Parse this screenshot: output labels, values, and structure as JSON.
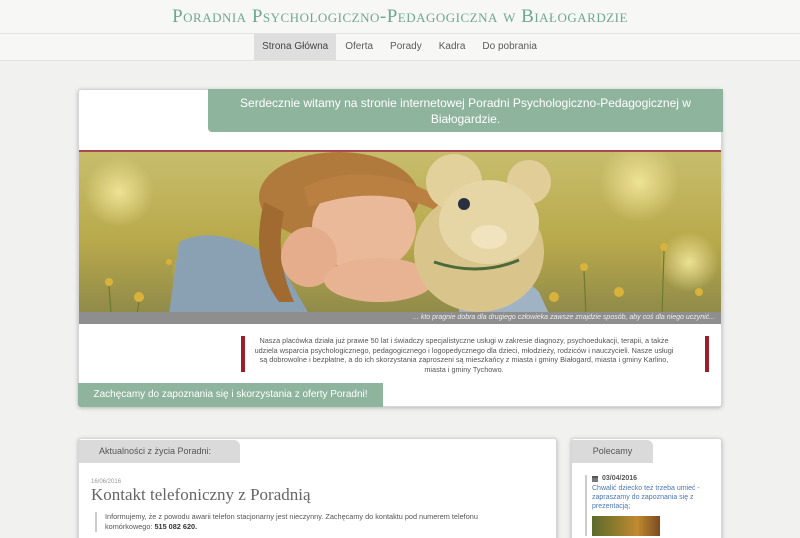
{
  "site": {
    "title": "Poradnia Psychologiczno-Pedagogiczna w Białogardzie"
  },
  "nav": {
    "items": [
      {
        "label": "Strona Główna",
        "active": true
      },
      {
        "label": "Oferta",
        "active": false
      },
      {
        "label": "Porady",
        "active": false
      },
      {
        "label": "Kadra",
        "active": false
      },
      {
        "label": "Do pobrania",
        "active": false
      }
    ]
  },
  "welcome": {
    "heading": "Serdecznie witamy na stronie internetowej Poradni Psychologiczno-Pedagogicznej w Białogardzie.",
    "image_caption": "... kto pragnie dobra dla drugiego człowieka zawsze znajdzie sposób, aby coś dla niego uczynić...",
    "intro": "Nasza placówka działa już prawie 50 lat i świadczy specjalistyczne usługi w zakresie diagnozy, psychoedukacji, terapii, a także udziela wsparcia psychologicznego, pedagogicznego i logopedycznego dla dzieci, młodzieży, rodziców i nauczycieli. Nasze usługi są dobrowolne i bezpłatne, a do ich skorzystania zaproszeni są mieszkańcy z miasta i gminy Białogard, miasta i gminy Karlino, miasta i gminy Tychowo.",
    "cta": "Zachęcamy do zapoznania się i skorzystania z oferty Poradni!"
  },
  "news": {
    "tab_label": "Aktualności z życia Poradni:",
    "date": "16/06/2016",
    "title": "Kontakt telefoniczny z Poradnią",
    "body": "Informujemy, że z powodu awarii telefon stacjonarny jest nieczynny. Zachęcamy do kontaktu pod numerem telefonu komórkowego:",
    "phone": "515 082 620."
  },
  "recommended": {
    "tab_label": "Polecamy",
    "date": "03/04/2016",
    "link": "Chwalić dziecko też trzeba umieć - zapraszamy do zapoznania się z prezentacją;"
  },
  "colors": {
    "accent_green": "#8fb49d",
    "title_green": "#6fa890",
    "accent_red": "#9a1e2c",
    "link_blue": "#4a77b4"
  }
}
